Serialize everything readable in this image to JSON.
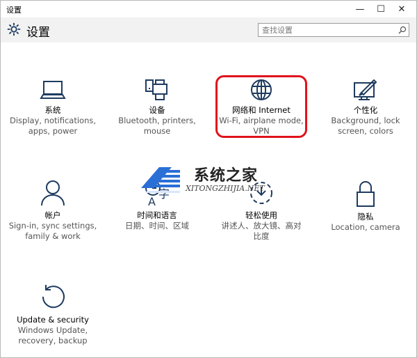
{
  "window": {
    "title": "设置",
    "controls": {
      "minimize": "—",
      "maximize": "☐",
      "close": "✕"
    }
  },
  "header": {
    "title": "设置",
    "search_placeholder": "查找设置"
  },
  "tiles": [
    {
      "id": "system",
      "icon": "laptop-icon",
      "title": "系统",
      "desc": [
        "Display, notifications,",
        "apps, power"
      ]
    },
    {
      "id": "devices",
      "icon": "printer-icon",
      "title": "设备",
      "desc": [
        "Bluetooth, printers,",
        "mouse"
      ]
    },
    {
      "id": "network",
      "icon": "globe-icon",
      "title": "网络和 Internet",
      "desc": [
        "Wi-Fi, airplane mode,",
        "VPN"
      ]
    },
    {
      "id": "personalization",
      "icon": "paint-icon",
      "title": "个性化",
      "desc": [
        "Background, lock",
        "screen, colors"
      ]
    },
    {
      "id": "accounts",
      "icon": "person-icon",
      "title": "帐户",
      "desc": [
        "Sign-in, sync settings,",
        "family & work"
      ]
    },
    {
      "id": "time-language",
      "icon": "time-language-icon",
      "title": "时间和语言",
      "desc": [
        "日期、时间、区域",
        ""
      ]
    },
    {
      "id": "ease-of-access",
      "icon": "ease-of-access-icon",
      "title": "轻松使用",
      "desc": [
        "讲述人、放大镜、高对",
        "比度"
      ]
    },
    {
      "id": "privacy",
      "icon": "lock-icon",
      "title": "隐私",
      "desc": [
        "Location, camera",
        ""
      ]
    },
    {
      "id": "update-security",
      "icon": "sync-icon",
      "title": "Update & security",
      "desc": [
        "Windows Update,",
        "recovery, backup"
      ]
    }
  ],
  "watermark": {
    "title": "系统之家",
    "subtitle": "XITONGZHIJIA.NET"
  },
  "colors": {
    "accent": "#1e3b5f",
    "highlight": "#e0121b",
    "header_bg": "#f2f2f2"
  }
}
